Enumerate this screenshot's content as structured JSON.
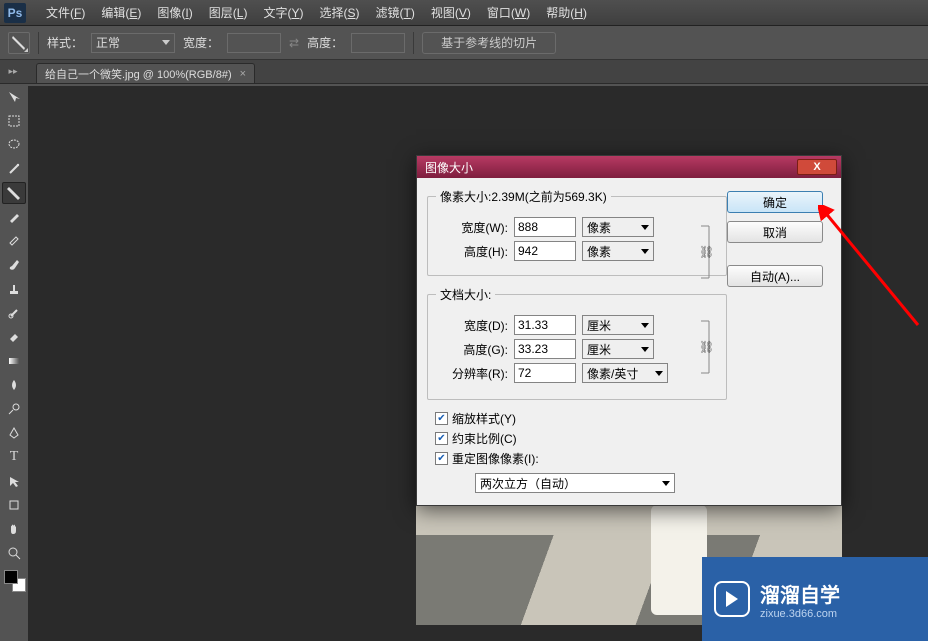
{
  "menu": {
    "items": [
      {
        "label": "文件",
        "u": "F"
      },
      {
        "label": "编辑",
        "u": "E"
      },
      {
        "label": "图像",
        "u": "I"
      },
      {
        "label": "图层",
        "u": "L"
      },
      {
        "label": "文字",
        "u": "Y"
      },
      {
        "label": "选择",
        "u": "S"
      },
      {
        "label": "滤镜",
        "u": "T"
      },
      {
        "label": "视图",
        "u": "V"
      },
      {
        "label": "窗口",
        "u": "W"
      },
      {
        "label": "帮助",
        "u": "H"
      }
    ]
  },
  "opt": {
    "style_label": "样式：",
    "style_value": "正常",
    "width_label": "宽度：",
    "height_label": "高度：",
    "swap": "⇄",
    "btn": "基于参考线的切片"
  },
  "tab": {
    "title": "给自己一个微笑.jpg @ 100%(RGB/8#)"
  },
  "dialog": {
    "title": "图像大小",
    "pixel_legend_prefix": "像素大小:",
    "pixel_size": "2.39M",
    "pixel_prev": "(之前为569.3K)",
    "width_label": "宽度(W):",
    "height_label": "高度(H):",
    "width_val": "888",
    "height_val": "942",
    "px_unit": "像素",
    "doc_legend": "文档大小:",
    "dwidth_label": "宽度(D):",
    "dheight_label": "高度(G):",
    "res_label": "分辨率(R):",
    "dwidth_val": "31.33",
    "dheight_val": "33.23",
    "res_val": "72",
    "cm_unit": "厘米",
    "res_unit": "像素/英寸",
    "scale_styles": "缩放样式(Y)",
    "constrain": "约束比例(C)",
    "resample": "重定图像像素(I):",
    "resample_value": "两次立方（自动）",
    "ok": "确定",
    "cancel": "取消",
    "auto": "自动(A)..."
  },
  "watermark": {
    "big": "溜溜自学",
    "small": "zixue.3d66.com"
  }
}
